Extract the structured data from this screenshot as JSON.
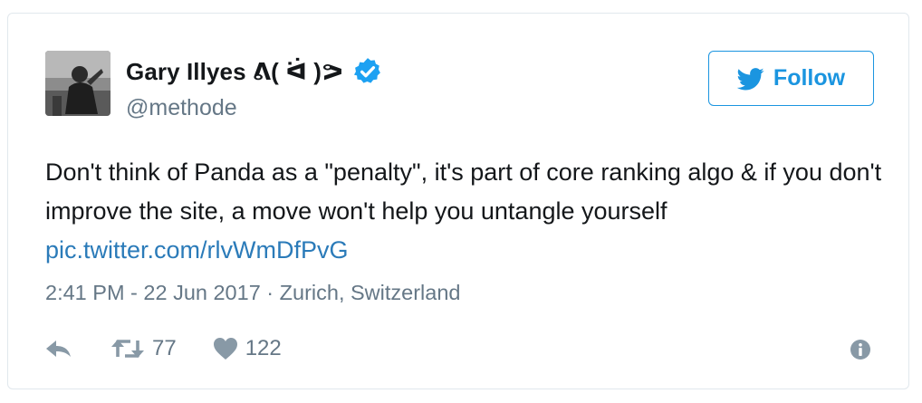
{
  "tweet": {
    "author_name": "Gary Illyes ᕕ( ᐛ )ᕗ",
    "handle": "@methode",
    "verified": true,
    "follow_label": "Follow",
    "text": "Don't think of Panda as a \"penalty\", it's part of core ranking algo & if you don't improve the site, a move won't help you untangle yourself ",
    "link_text": "pic.twitter.com/rlvWmDfPvG",
    "timestamp": "2:41 PM - 22 Jun 2017",
    "separator": " · ",
    "location": "Zurich, Switzerland",
    "retweet_count": "77",
    "like_count": "122"
  },
  "icons": {
    "avatar": "avatar-photo",
    "verified": "verified-badge-icon",
    "follow": "twitter-bird-icon",
    "reply": "reply-icon",
    "retweet": "retweet-icon",
    "like": "heart-icon",
    "info": "info-icon"
  },
  "colors": {
    "brand_blue": "#1b95e0",
    "link_blue": "#2b7bb9",
    "verified_blue": "#1da1f2",
    "text": "#14171a",
    "secondary_text": "#657786",
    "icon_gray": "#8899a6",
    "border": "#e1e8ed"
  }
}
